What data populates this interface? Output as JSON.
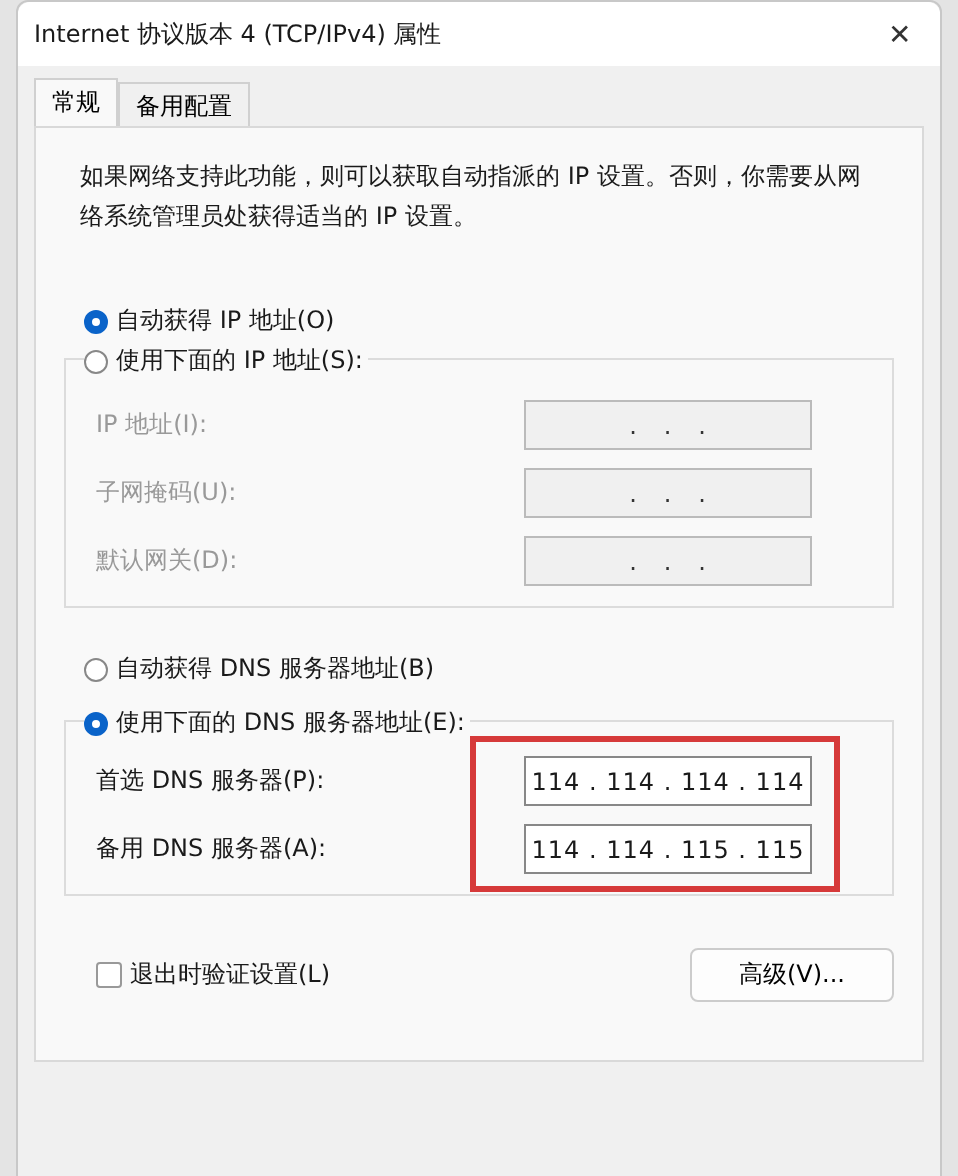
{
  "window": {
    "title": "Internet 协议版本 4 (TCP/IPv4) 属性",
    "close": "✕"
  },
  "tabs": [
    {
      "label": "常规",
      "selected": true
    },
    {
      "label": "备用配置",
      "selected": false
    }
  ],
  "description": "如果网络支持此功能，则可以获取自动指派的 IP 设置。否则，你需要从网络系统管理员处获得适当的 IP 设置。",
  "ip_options": [
    {
      "label": "自动获得 IP 地址(O)",
      "selected": true
    },
    {
      "label": "使用下面的 IP 地址(S):",
      "selected": false
    }
  ],
  "ip_fields": [
    {
      "label": "IP 地址(I):",
      "value": ".   .   .",
      "disabled": true
    },
    {
      "label": "子网掩码(U):",
      "value": ".   .   .",
      "disabled": true
    },
    {
      "label": "默认网关(D):",
      "value": ".   .   .",
      "disabled": true
    }
  ],
  "dns_options": [
    {
      "label": "自动获得 DNS 服务器地址(B)",
      "selected": false
    },
    {
      "label": "使用下面的 DNS 服务器地址(E):",
      "selected": true
    }
  ],
  "dns_fields": [
    {
      "label": "首选 DNS 服务器(P):",
      "value": "114 . 114 . 114 . 114",
      "disabled": false
    },
    {
      "label": "备用 DNS 服务器(A):",
      "value": "114 . 114 . 115 . 115",
      "disabled": false
    }
  ],
  "validate_on_exit": {
    "label": "退出时验证设置(L)",
    "checked": false
  },
  "advanced_button": "高级(V)..."
}
